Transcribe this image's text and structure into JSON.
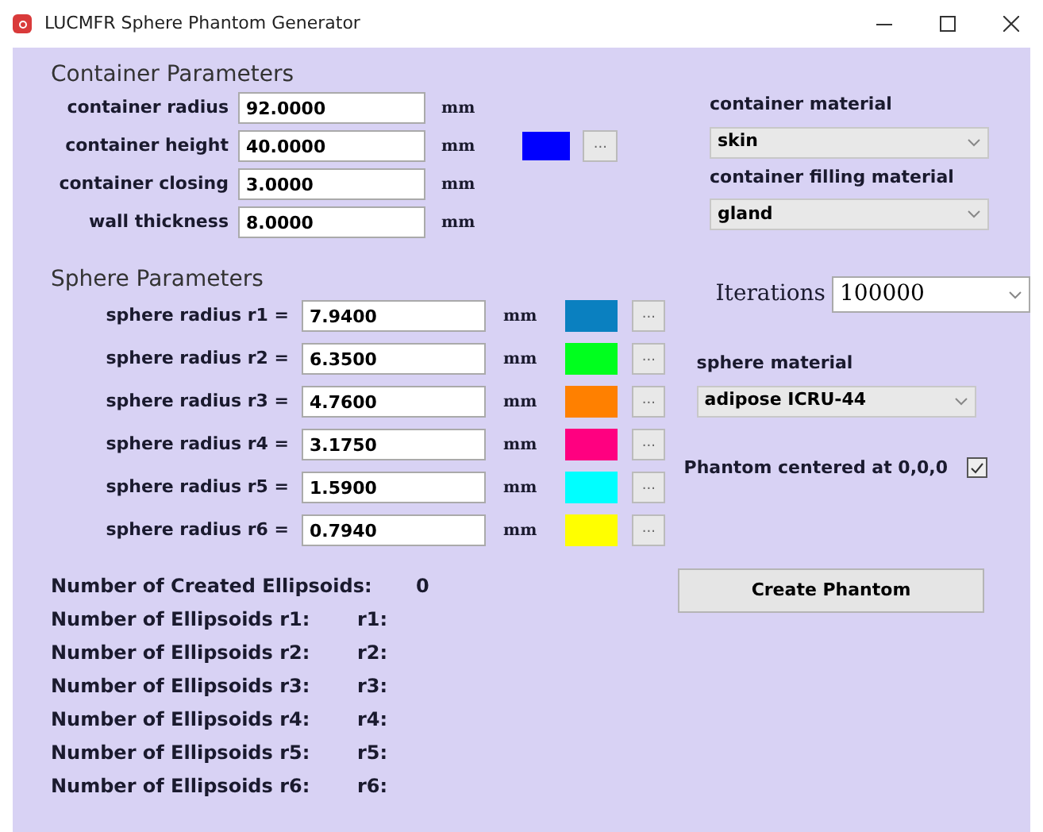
{
  "window": {
    "title": "LUCMFR Sphere Phantom Generator"
  },
  "container": {
    "title": "Container Parameters",
    "fields": [
      {
        "label": "container radius",
        "value": "92.0000",
        "unit": "mm"
      },
      {
        "label": "container height",
        "value": "40.0000",
        "unit": "mm"
      },
      {
        "label": "container closing",
        "value": "3.0000",
        "unit": "mm"
      },
      {
        "label": "wall thickness",
        "value": "8.0000",
        "unit": "mm"
      }
    ],
    "color": "#0000ff",
    "color_button": "...",
    "material_label": "container material",
    "material": "skin",
    "filling_label": "container filling material",
    "filling": "gland"
  },
  "spheres": {
    "title": "Sphere Parameters",
    "rows": [
      {
        "label": "sphere radius r1 =",
        "value": "7.9400",
        "unit": "mm",
        "color": "#0a80c0",
        "button": "..."
      },
      {
        "label": "sphere radius r2 =",
        "value": "6.3500",
        "unit": "mm",
        "color": "#00ff1e",
        "button": "..."
      },
      {
        "label": "sphere radius r3 =",
        "value": "4.7600",
        "unit": "mm",
        "color": "#ff8000",
        "button": "..."
      },
      {
        "label": "sphere radius r4 =",
        "value": "3.1750",
        "unit": "mm",
        "color": "#ff0080",
        "button": "..."
      },
      {
        "label": "sphere radius r5 =",
        "value": "1.5900",
        "unit": "mm",
        "color": "#00ffff",
        "button": "..."
      },
      {
        "label": "sphere radius r6 =",
        "value": "0.7940",
        "unit": "mm",
        "color": "#ffff00",
        "button": "..."
      }
    ],
    "iterations_label": "Iterations",
    "iterations": "100000",
    "material_label": "sphere material",
    "material": "adipose ICRU-44",
    "centered_label": "Phantom centered at 0,0,0",
    "centered": true
  },
  "results": [
    {
      "label": "Number of Created Ellipsoids:",
      "value": "0"
    },
    {
      "label": "Number of Ellipsoids r1:",
      "value": "r1:"
    },
    {
      "label": "Number of Ellipsoids r2:",
      "value": "r2:"
    },
    {
      "label": "Number of Ellipsoids r3:",
      "value": "r3:"
    },
    {
      "label": "Number of Ellipsoids r4:",
      "value": "r4:"
    },
    {
      "label": "Number of Ellipsoids r5:",
      "value": "r5:"
    },
    {
      "label": "Number of Ellipsoids r6:",
      "value": "r6:"
    }
  ],
  "create_button": "Create Phantom"
}
